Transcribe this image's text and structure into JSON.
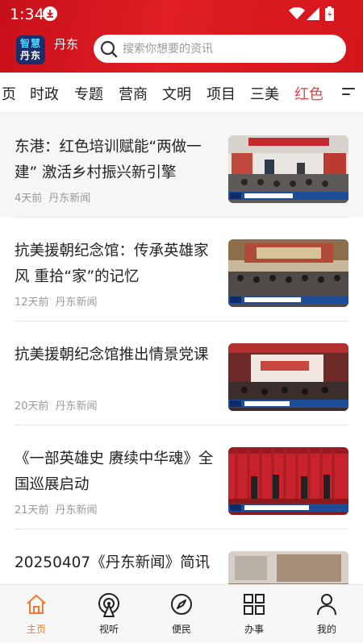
{
  "status_bar": {
    "time": "1:34"
  },
  "header": {
    "logo_line1": "智慧",
    "logo_line2": "丹东",
    "city": "丹东",
    "search_placeholder": "搜索你想要的资讯"
  },
  "tabs": [
    {
      "label": "页"
    },
    {
      "label": "时政"
    },
    {
      "label": "专题"
    },
    {
      "label": "营商"
    },
    {
      "label": "文明"
    },
    {
      "label": "项目"
    },
    {
      "label": "三美"
    },
    {
      "label": "红色",
      "active": true
    }
  ],
  "news": [
    {
      "title": "东港：红色培训赋能“两做一建” 激活乡村振兴新引擎",
      "time": "4天前",
      "source": "丹东新闻",
      "image": "meeting-hall-photo"
    },
    {
      "title": "抗美援朝纪念馆：传承英雄家风  重拾“家”的记忆",
      "time": "12天前",
      "source": "丹东新闻",
      "image": "lecture-hall-photo"
    },
    {
      "title": "抗美援朝纪念馆推出情景党课",
      "time": "20天前",
      "source": "丹东新闻",
      "image": "stage-performance-photo"
    },
    {
      "title": "《一部英雄史    赓续中华魂》全国巡展启动",
      "time": "21天前",
      "source": "丹东新闻",
      "image": "ceremony-red-curtain-photo"
    },
    {
      "title": "20250407《丹东新闻》简讯",
      "time": "",
      "source": "",
      "image": "news-brief-photo"
    }
  ],
  "bottom_nav": [
    {
      "label": "主页",
      "icon": "home-icon",
      "active": true
    },
    {
      "label": "视听",
      "icon": "broadcast-icon"
    },
    {
      "label": "便民",
      "icon": "compass-icon"
    },
    {
      "label": "办事",
      "icon": "grid-icon"
    },
    {
      "label": "我的",
      "icon": "user-icon"
    }
  ],
  "colors": {
    "brand_red": "#d4161c",
    "active_tab": "#e0464a",
    "active_nav": "#f07a2a"
  }
}
